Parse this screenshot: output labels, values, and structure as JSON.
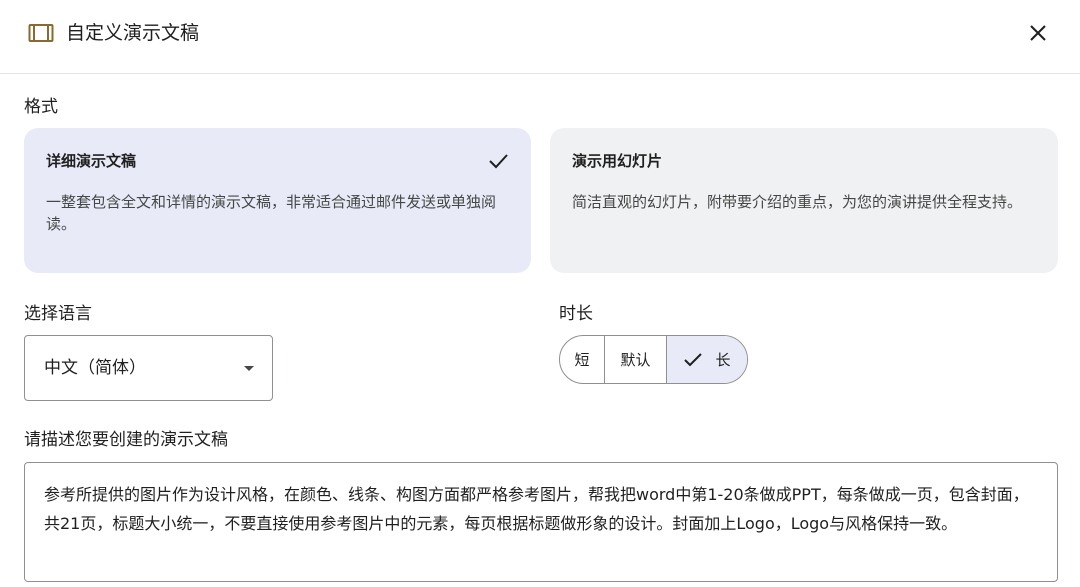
{
  "dialog": {
    "title": "自定义演示文稿",
    "icon": "presentation-icon",
    "close_icon": "close-icon"
  },
  "format": {
    "label": "格式",
    "options": [
      {
        "title": "详细演示文稿",
        "description": "一整套包含全文和详情的演示文稿，非常适合通过邮件发送或单独阅读。",
        "selected": true
      },
      {
        "title": "演示用幻灯片",
        "description": "简洁直观的幻灯片，附带要介绍的重点，为您的演讲提供全程支持。",
        "selected": false
      }
    ]
  },
  "language": {
    "label": "选择语言",
    "value": "中文（简体）"
  },
  "duration": {
    "label": "时长",
    "options": [
      "短",
      "默认",
      "长"
    ],
    "selected": "长"
  },
  "description": {
    "label": "请描述您要创建的演示文稿",
    "value": "参考所提供的图片作为设计风格，在颜色、线条、构图方面都严格参考图片，帮我把word中第1-20条做成PPT，每条做成一页，包含封面，共21页，标题大小统一，不要直接使用参考图片中的元素，每页根据标题做形象的设计。封面加上Logo，Logo与风格保持一致。"
  },
  "colors": {
    "selected_bg": "#e8ebf7",
    "card_bg": "#f0f1f3",
    "icon_brown": "#8a6a2e",
    "border": "#8e918f"
  }
}
